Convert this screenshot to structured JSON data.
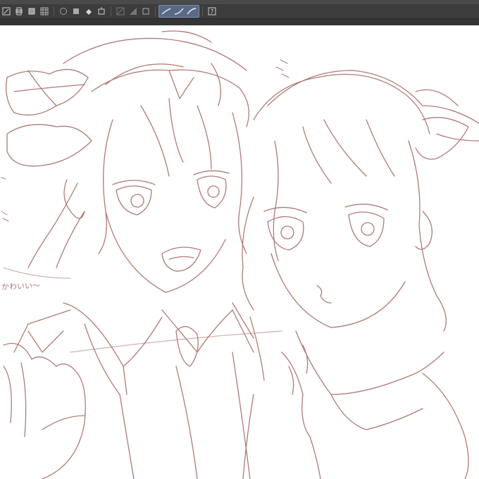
{
  "toolbar": {
    "icons": [
      "pen-tool-icon",
      "brush-tool-icon",
      "eraser-tool-icon",
      "grid-icon",
      "radial-icon",
      "paint-bucket-icon",
      "transform-icon",
      "lock-icon",
      "hatch-icon",
      "square-icon",
      "stroke-smooth-icon",
      "stroke-curve-icon",
      "stroke-ramp-icon",
      "help-icon"
    ],
    "active_group": "stroke-mode",
    "colors": {
      "bar": "#3c3c3c",
      "active": "#5a6a85",
      "icon": "#d0d0d0"
    }
  },
  "canvas": {
    "annotation_text": "かわいい〜",
    "line_color": "#b07a76"
  }
}
